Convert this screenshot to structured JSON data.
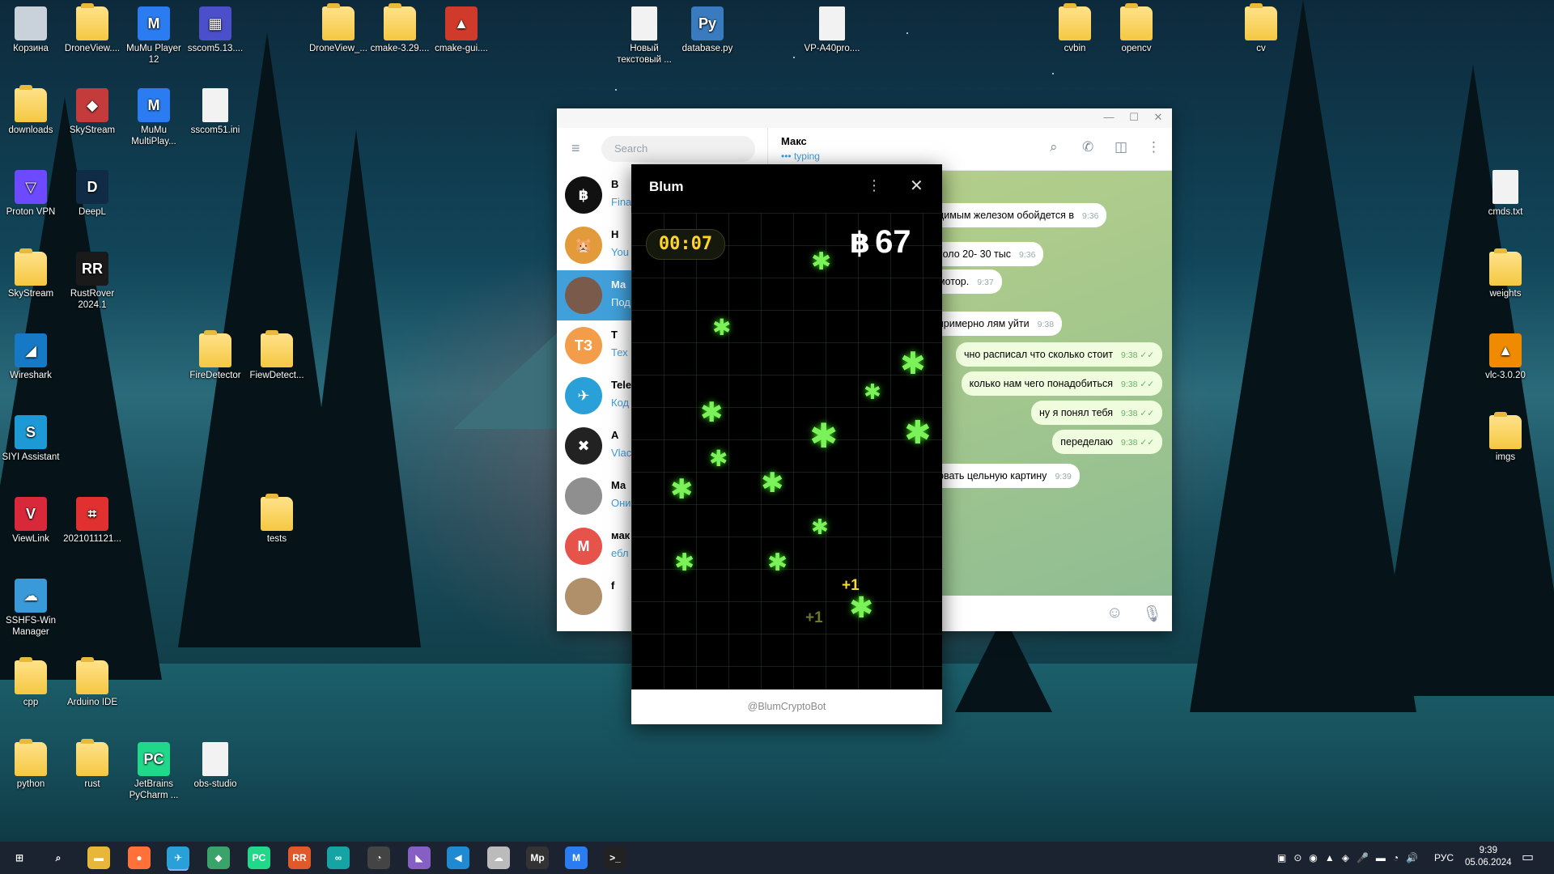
{
  "desktop": {
    "icons": [
      {
        "label": "Корзина",
        "kind": "bin",
        "color": "#c9d2da"
      },
      {
        "label": "DroneView....",
        "kind": "folder"
      },
      {
        "label": "MuMu Player 12",
        "kind": "app",
        "color": "#2a7cf0",
        "glyph": "M"
      },
      {
        "label": "sscom5.13....",
        "kind": "app",
        "color": "#4b4fc9",
        "glyph": "▦"
      },
      {
        "label": "DroneView_...",
        "kind": "folder"
      },
      {
        "label": "cmake-3.29....",
        "kind": "folder"
      },
      {
        "label": "cmake-gui....",
        "kind": "app",
        "color": "#d03a2a",
        "glyph": "▲"
      },
      {
        "label": "Новый текстовый ...",
        "kind": "file"
      },
      {
        "label": "database.py",
        "kind": "app",
        "color": "#3a7bbf",
        "glyph": "Py"
      },
      {
        "label": "VP-A40pro....",
        "kind": "file"
      },
      {
        "label": "cvbin",
        "kind": "folder"
      },
      {
        "label": "opencv",
        "kind": "folder"
      },
      {
        "label": "cv",
        "kind": "folder"
      },
      {
        "label": "downloads",
        "kind": "folder"
      },
      {
        "label": "SkyStream",
        "kind": "app",
        "color": "#c43b3b",
        "glyph": "◆"
      },
      {
        "label": "MuMu MultiPlay...",
        "kind": "app",
        "color": "#2a7cf0",
        "glyph": "M"
      },
      {
        "label": "sscom51.ini",
        "kind": "file"
      },
      {
        "label": "Proton VPN",
        "kind": "app",
        "color": "#6d4aff",
        "glyph": "▽"
      },
      {
        "label": "DeepL",
        "kind": "app",
        "color": "#0f2b46",
        "glyph": "D"
      },
      {
        "label": "cmds.txt",
        "kind": "file"
      },
      {
        "label": "SkyStream",
        "kind": "folder"
      },
      {
        "label": "RustRover 2024.1",
        "kind": "app",
        "color": "#1a1a1a",
        "glyph": "RR"
      },
      {
        "label": "weights",
        "kind": "folder"
      },
      {
        "label": "Wireshark",
        "kind": "app",
        "color": "#1679c5",
        "glyph": "◢"
      },
      {
        "label": "FireDetector",
        "kind": "folder"
      },
      {
        "label": "FiewDetect...",
        "kind": "folder"
      },
      {
        "label": "vlc-3.0.20",
        "kind": "app",
        "color": "#f08a00",
        "glyph": "▲"
      },
      {
        "label": "SIYI Assistant",
        "kind": "app",
        "color": "#1d9ad6",
        "glyph": "S"
      },
      {
        "label": "imgs",
        "kind": "folder"
      },
      {
        "label": "ViewLink",
        "kind": "app",
        "color": "#d8293a",
        "glyph": "V"
      },
      {
        "label": "2021011121...",
        "kind": "app",
        "color": "#e03030",
        "glyph": "⌗"
      },
      {
        "label": "tests",
        "kind": "folder"
      },
      {
        "label": "SSHFS-Win Manager",
        "kind": "app",
        "color": "#3a9ad9",
        "glyph": "☁"
      },
      {
        "label": "cpp",
        "kind": "folder"
      },
      {
        "label": "Arduino IDE",
        "kind": "folder"
      },
      {
        "label": "python",
        "kind": "folder"
      },
      {
        "label": "rust",
        "kind": "folder"
      },
      {
        "label": "JetBrains PyCharm ...",
        "kind": "app",
        "color": "#21d789",
        "glyph": "PC"
      },
      {
        "label": "obs-studio",
        "kind": "file"
      }
    ]
  },
  "telegram": {
    "search_placeholder": "Search",
    "chats": [
      {
        "name": "B",
        "preview": "Fina",
        "color": "#111",
        "glyph": "฿"
      },
      {
        "name": "H",
        "preview": "You",
        "color": "#e39a3b",
        "glyph": "🐹"
      },
      {
        "name": "Ма",
        "preview": "Под",
        "color": "#7a5a4a",
        "glyph": "",
        "active": true
      },
      {
        "name": "Т",
        "preview": "Тех",
        "color": "#f39c4a",
        "glyph": "ТЗ"
      },
      {
        "name": "Tele",
        "preview": "Код",
        "color": "#2aa0d8",
        "glyph": "✈"
      },
      {
        "name": "А",
        "preview": "Vlac",
        "color": "#222",
        "glyph": "✖"
      },
      {
        "name": "Ма",
        "preview": "Они",
        "color": "#8f8f8f",
        "glyph": ""
      },
      {
        "name": "мак",
        "preview": "ебл",
        "color": "#e5534b",
        "glyph": "М"
      },
      {
        "name": "f",
        "preview": "",
        "color": "#b0906a",
        "glyph": ""
      }
    ],
    "peer_name": "Макс",
    "peer_status": "••• typing",
    "messages": [
      {
        "text": "димым железом обойдется в",
        "time": "9:36",
        "out": false
      },
      {
        "text": "коло 20- 30 тыс",
        "time": "9:36",
        "out": false
      },
      {
        "text": "мотор.",
        "time": "9:37",
        "out": false
      },
      {
        "text": "примерно лям уйти",
        "time": "9:38",
        "out": false
      },
      {
        "text": "чно расписал что сколько стоит",
        "time": "9:38",
        "out": true
      },
      {
        "text": "колько нам чего понадобиться",
        "time": "9:38",
        "out": true
      },
      {
        "text": "ну я понял тебя",
        "time": "9:38",
        "out": true
      },
      {
        "text": "переделаю",
        "time": "9:38",
        "out": true
      },
      {
        "text": "овать цельную картину",
        "time": "9:39",
        "out": false
      }
    ]
  },
  "blum": {
    "title": "Blum",
    "timer": "00:07",
    "currency": "฿",
    "score": "67",
    "plus_label": "+1",
    "footer": "@BlumCryptoBot",
    "flake_color": "#7cf25a"
  },
  "taskbar": {
    "language": "РУС",
    "time": "9:39",
    "date": "05.06.2024",
    "apps": [
      {
        "name": "start",
        "glyph": "⊞",
        "color": "#1b2330"
      },
      {
        "name": "search",
        "glyph": "⌕",
        "color": "#1b2330"
      },
      {
        "name": "explorer",
        "glyph": "▬",
        "color": "#e8b73a"
      },
      {
        "name": "firefox",
        "glyph": "●",
        "color": "#ff7139"
      },
      {
        "name": "telegram",
        "glyph": "✈",
        "color": "#2aa0d8"
      },
      {
        "name": "app5",
        "glyph": "◆",
        "color": "#3aa36a"
      },
      {
        "name": "pycharm",
        "glyph": "PC",
        "color": "#21d789"
      },
      {
        "name": "rustrover",
        "glyph": "RR",
        "color": "#e0592a"
      },
      {
        "name": "arduino",
        "glyph": "∞",
        "color": "#15a3a3"
      },
      {
        "name": "app9",
        "glyph": "◔",
        "color": "#444"
      },
      {
        "name": "visual-studio",
        "glyph": "◣",
        "color": "#865fc5"
      },
      {
        "name": "vscode",
        "glyph": "◀",
        "color": "#1f8ad2"
      },
      {
        "name": "app12",
        "glyph": "☁",
        "color": "#bbb"
      },
      {
        "name": "mp",
        "glyph": "Mp",
        "color": "#333"
      },
      {
        "name": "mumu",
        "glyph": "M",
        "color": "#2a7cf0"
      },
      {
        "name": "terminal",
        "glyph": ">_",
        "color": "#222"
      }
    ]
  }
}
